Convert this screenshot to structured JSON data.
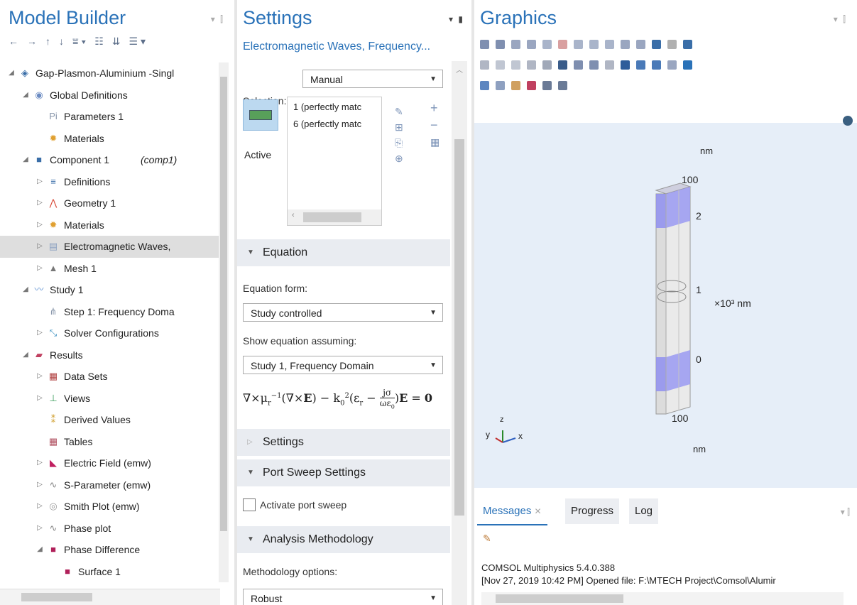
{
  "model_builder": {
    "title": "Model Builder",
    "tree": [
      {
        "label": "Gap-Plasmon-Aluminium -Singl",
        "indent": 0,
        "arrow": "◢",
        "icon": "◈",
        "color": "#3a6ea8"
      },
      {
        "label": "Global Definitions",
        "indent": 1,
        "arrow": "◢",
        "icon": "◉",
        "color": "#6b8bc2"
      },
      {
        "label": "Parameters 1",
        "indent": 2,
        "arrow": "",
        "icon": "Pi",
        "color": "#8896aa"
      },
      {
        "label": "Materials",
        "indent": 2,
        "arrow": "",
        "icon": "✹",
        "color": "#e0a030"
      },
      {
        "label": "Component 1",
        "italic": "(comp1)",
        "indent": 1,
        "arrow": "◢",
        "icon": "■",
        "color": "#3a6ea8"
      },
      {
        "label": "Definitions",
        "indent": 2,
        "arrow": "▷",
        "icon": "≡",
        "color": "#3a6ea8"
      },
      {
        "label": "Geometry 1",
        "indent": 2,
        "arrow": "▷",
        "icon": "⋀",
        "color": "#d84b3a"
      },
      {
        "label": "Materials",
        "indent": 2,
        "arrow": "▷",
        "icon": "✹",
        "color": "#e0a030"
      },
      {
        "label": "Electromagnetic Waves,",
        "indent": 2,
        "arrow": "▷",
        "icon": "▤",
        "color": "#8aa0c0",
        "selected": true
      },
      {
        "label": "Mesh 1",
        "indent": 2,
        "arrow": "▷",
        "icon": "▲",
        "color": "#777"
      },
      {
        "label": "Study 1",
        "indent": 1,
        "arrow": "◢",
        "icon": "〰",
        "color": "#5a8fd0"
      },
      {
        "label": "Step 1: Frequency Doma",
        "indent": 2,
        "arrow": "",
        "icon": "⋔",
        "color": "#8896aa"
      },
      {
        "label": "Solver Configurations",
        "indent": 2,
        "arrow": "▷",
        "icon": "⤡",
        "color": "#3a8fc0"
      },
      {
        "label": "Results",
        "indent": 1,
        "arrow": "◢",
        "icon": "▰",
        "color": "#c04060"
      },
      {
        "label": "Data Sets",
        "indent": 2,
        "arrow": "▷",
        "icon": "▦",
        "color": "#b04040"
      },
      {
        "label": "Views",
        "indent": 2,
        "arrow": "▷",
        "icon": "⊥",
        "color": "#40a060"
      },
      {
        "label": "Derived Values",
        "indent": 2,
        "arrow": "",
        "icon": "⁑",
        "color": "#d0a030"
      },
      {
        "label": "Tables",
        "indent": 2,
        "arrow": "",
        "icon": "▦",
        "color": "#b05060"
      },
      {
        "label": "Electric Field (emw)",
        "indent": 2,
        "arrow": "▷",
        "icon": "◣",
        "color": "#c02060"
      },
      {
        "label": "S-Parameter (emw)",
        "indent": 2,
        "arrow": "▷",
        "icon": "∿",
        "color": "#888"
      },
      {
        "label": "Smith Plot (emw)",
        "indent": 2,
        "arrow": "▷",
        "icon": "◎",
        "color": "#999"
      },
      {
        "label": "Phase plot",
        "indent": 2,
        "arrow": "▷",
        "icon": "∿",
        "color": "#888"
      },
      {
        "label": "Phase Difference",
        "indent": 2,
        "arrow": "◢",
        "icon": "■",
        "color": "#b0205a"
      },
      {
        "label": "Surface 1",
        "indent": 3,
        "arrow": "",
        "icon": "■",
        "color": "#b0205a"
      }
    ]
  },
  "settings": {
    "title": "Settings",
    "subtitle": "Electromagnetic Waves, Frequency...",
    "selection_label": "Selection:",
    "selection_value": "Manual",
    "active_label": "Active",
    "selection_items": [
      "1 (perfectly matc",
      "6 (perfectly matc"
    ],
    "equation_section": "Equation",
    "equation_form_label": "Equation form:",
    "equation_form_value": "Study controlled",
    "show_equation_label": "Show equation assuming:",
    "show_equation_value": "Study 1, Frequency Domain",
    "settings_section": "Settings",
    "port_sweep_section": "Port Sweep Settings",
    "activate_port_sweep": "Activate port sweep",
    "analysis_section": "Analysis Methodology",
    "methodology_label": "Methodology options:",
    "methodology_value": "Robust"
  },
  "graphics": {
    "title": "Graphics",
    "axis_labels": {
      "top_unit": "nm",
      "top_100": "100",
      "v2": "2",
      "v1": "1",
      "exp_unit": "×10³ nm",
      "v0": "0",
      "bottom_100": "100",
      "bottom_unit": "nm",
      "triad_y": "y",
      "triad_z": "z",
      "triad_x": "x"
    }
  },
  "messages": {
    "tabs": [
      "Messages",
      "Progress",
      "Log"
    ],
    "lines": [
      "COMSOL Multiphysics 5.4.0.388",
      "[Nov 27, 2019 10:42 PM] Opened file: F:\\MTECH Project\\Comsol\\Alumir"
    ]
  },
  "colors": {
    "accent": "#2a72b8",
    "section_bg": "#e9ecf1",
    "canvas_bg": "#e6eef8",
    "highlight": "#8f8ff0"
  }
}
